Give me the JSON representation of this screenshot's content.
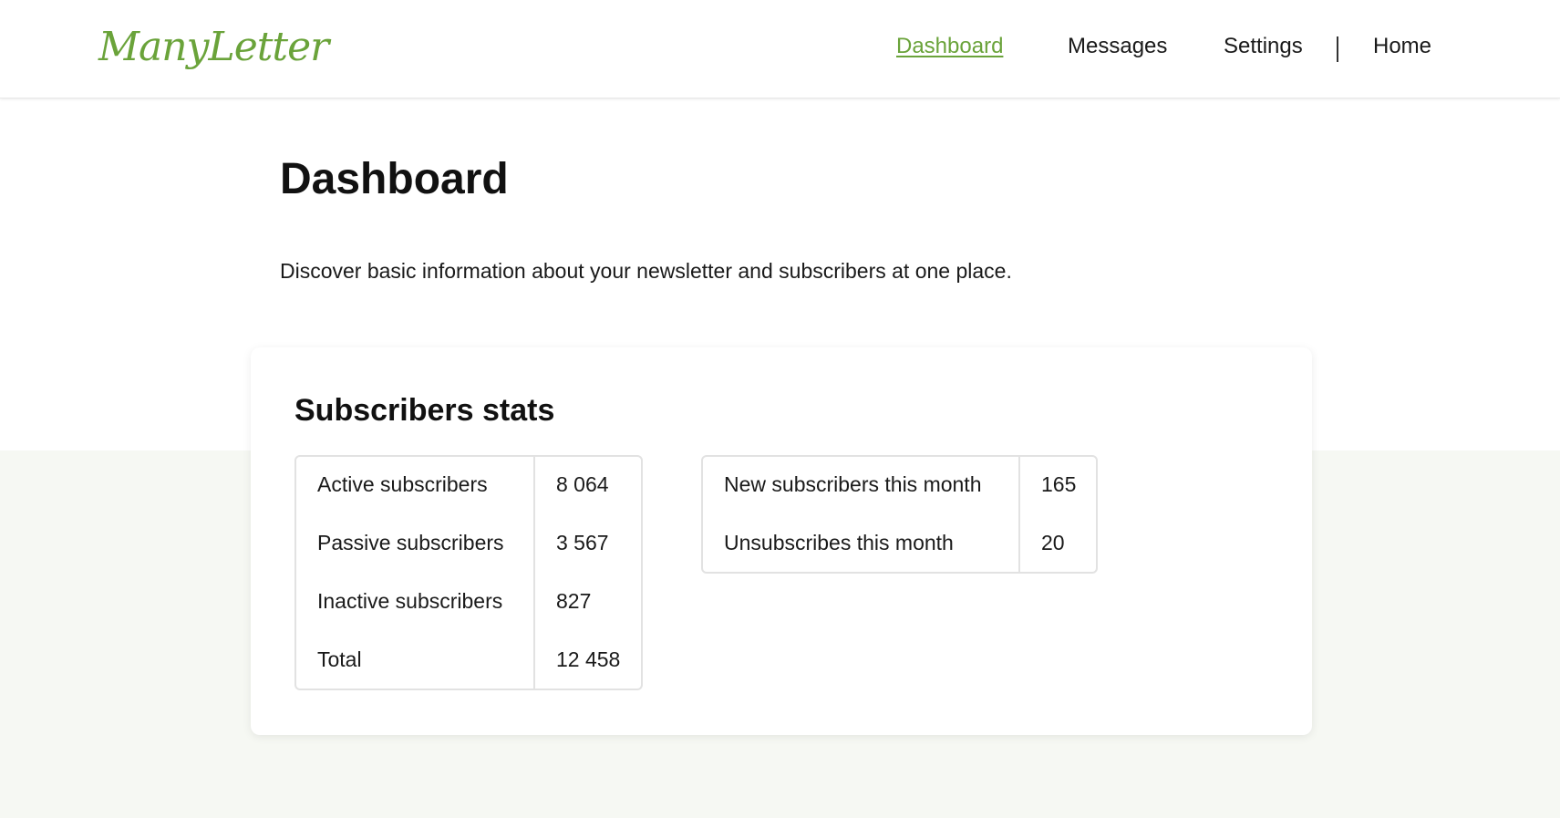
{
  "header": {
    "logo_text": "ManyLetter",
    "brand_color": "#6aa33a",
    "nav": {
      "dashboard": "Dashboard",
      "messages": "Messages",
      "settings": "Settings",
      "divider": "|",
      "home": "Home"
    }
  },
  "page": {
    "title": "Dashboard",
    "description": "Discover basic information about your newsletter and subscribers at one place."
  },
  "stats_card": {
    "title": "Subscribers stats",
    "table_left": [
      {
        "label": "Active subscribers",
        "value": "8 064"
      },
      {
        "label": "Passive subscribers",
        "value": "3 567"
      },
      {
        "label": "Inactive subscribers",
        "value": "827"
      },
      {
        "label": "Total",
        "value": "12 458"
      }
    ],
    "table_right": [
      {
        "label": "New subscribers this month",
        "value": "165"
      },
      {
        "label": "Unsubscribes this month",
        "value": "20"
      }
    ]
  }
}
